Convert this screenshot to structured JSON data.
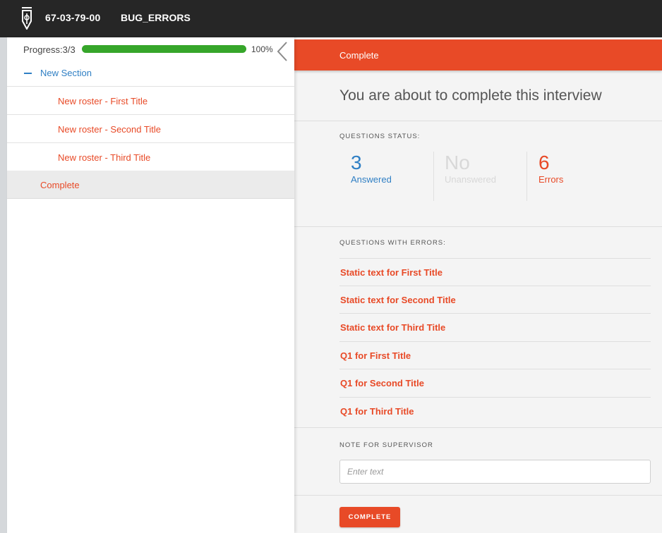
{
  "header": {
    "logo_icon": "pen-nib-icon",
    "interview_id": "67-03-79-00",
    "questionnaire_title": "BUG_ERRORS"
  },
  "sidebar": {
    "progress_label": "Progress:3/3",
    "progress_fraction": 1.0,
    "progress_percent": "100%",
    "progress_color": "#36a62a",
    "collapse_icon": "chevron-left-icon",
    "section_label": "New Section",
    "items": [
      {
        "label": "New roster - First Title"
      },
      {
        "label": "New roster - Second Title"
      },
      {
        "label": "New roster - Third Title"
      }
    ],
    "complete_label": "Complete"
  },
  "main": {
    "header_label": "Complete",
    "title": "You are about to complete this interview",
    "status_heading": "QUESTIONS STATUS:",
    "stats": {
      "answered": {
        "value": "3",
        "caption": "Answered",
        "color": "#2f7fc4"
      },
      "unanswered": {
        "value": "No",
        "caption": "Unanswered",
        "color": "#d8d8d8"
      },
      "errors": {
        "value": "6",
        "caption": "Errors",
        "color": "#e84a27"
      }
    },
    "errors_heading": "QUESTIONS WITH ERRORS:",
    "errors": [
      "Static text for First Title",
      "Static text for Second Title",
      "Static text for Third Title",
      "Q1 for First Title",
      "Q1 for Second Title",
      "Q1 for Third Title"
    ],
    "note_heading": "NOTE FOR SUPERVISOR",
    "note_placeholder": "Enter text",
    "note_value": "",
    "complete_button_label": "COMPLETE"
  },
  "colors": {
    "accent": "#e84a27",
    "topbar": "#262626",
    "link_blue": "#2f7fc4"
  }
}
